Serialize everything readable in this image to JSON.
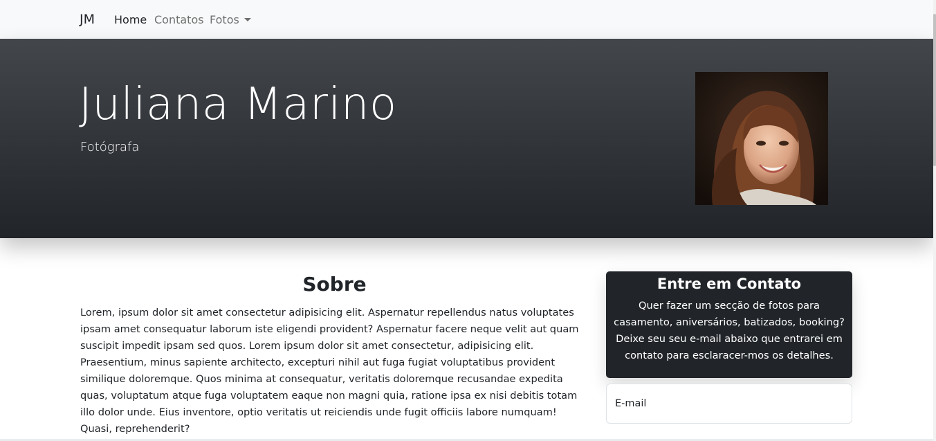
{
  "navbar": {
    "brand": "JM",
    "items": [
      {
        "label": "Home",
        "active": true
      },
      {
        "label": "Contatos",
        "active": false
      },
      {
        "label": "Fotos",
        "active": false,
        "dropdown": true
      }
    ]
  },
  "hero": {
    "title": "Juliana Marino",
    "subtitle": "Fotógrafa",
    "portrait_icon": "portrait-photo"
  },
  "about": {
    "title": "Sobre",
    "text": "Lorem, ipsum dolor sit amet consectetur adipisicing elit. Aspernatur repellendus natus voluptates ipsam amet consequatur laborum iste eligendi provident? Aspernatur facere neque velit aut quam suscipit impedit ipsam sed quos. Lorem ipsum dolor sit amet consectetur, adipisicing elit. Praesentium, minus sapiente architecto, excepturi nihil aut fuga fugiat voluptatibus provident similique doloremque. Quos minima at consequatur, veritatis doloremque recusandae expedita quas, voluptatum atque fuga voluptatem eaque non magni quia, ratione ipsa ex nisi debitis totam illo dolor unde. Eius inventore, optio veritatis ut reiciendis unde fugit officiis labore numquam! Quasi, reprehenderit?"
  },
  "contact": {
    "title": "Entre em Contato",
    "text": "Quer fazer um secção de fotos para casamento, aniversários, batizados, booking? Deixe seu seu e-mail abaixo que entrarei em contato para esclaracer-mos os detalhes.",
    "email_label": "E-mail"
  },
  "colors": {
    "navbar_bg": "#f8f9fa",
    "hero_dark": "#212529",
    "card_bg": "#212529"
  }
}
